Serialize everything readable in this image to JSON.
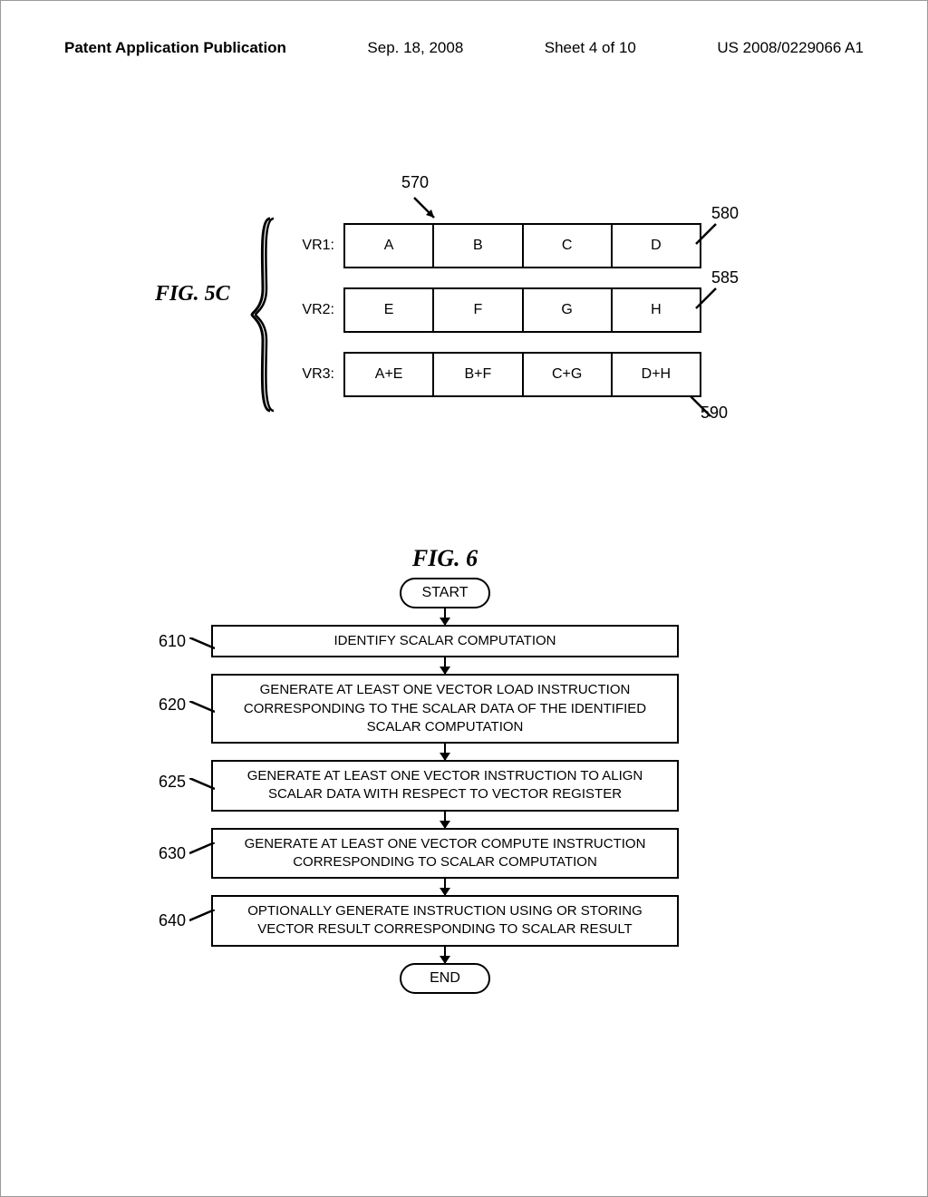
{
  "header": {
    "left": "Patent Application Publication",
    "mid_date": "Sep. 18, 2008",
    "mid_sheet": "Sheet 4 of 10",
    "right": "US 2008/0229066 A1"
  },
  "fig5c": {
    "label": "FIG. 5C",
    "ref570": "570",
    "ref580": "580",
    "ref585": "585",
    "ref590": "590",
    "rows": {
      "vr1_label": "VR1:",
      "vr1": {
        "c0": "A",
        "c1": "B",
        "c2": "C",
        "c3": "D"
      },
      "vr2_label": "VR2:",
      "vr2": {
        "c0": "E",
        "c1": "F",
        "c2": "G",
        "c3": "H"
      },
      "vr3_label": "VR3:",
      "vr3": {
        "c0": "A+E",
        "c1": "B+F",
        "c2": "C+G",
        "c3": "D+H"
      }
    }
  },
  "fig6": {
    "title": "FIG. 6",
    "start": "START",
    "end": "END",
    "step610": {
      "ref": "610",
      "text": "IDENTIFY SCALAR COMPUTATION"
    },
    "step620": {
      "ref": "620",
      "text": "GENERATE AT LEAST ONE VECTOR LOAD INSTRUCTION CORRESPONDING TO THE SCALAR DATA OF THE IDENTIFIED SCALAR COMPUTATION"
    },
    "step625": {
      "ref": "625",
      "text": "GENERATE AT LEAST ONE VECTOR INSTRUCTION TO ALIGN SCALAR DATA WITH RESPECT TO VECTOR REGISTER"
    },
    "step630": {
      "ref": "630",
      "text": "GENERATE AT LEAST ONE VECTOR COMPUTE INSTRUCTION CORRESPONDING TO SCALAR COMPUTATION"
    },
    "step640": {
      "ref": "640",
      "text": "OPTIONALLY GENERATE INSTRUCTION USING OR STORING VECTOR RESULT CORRESPONDING TO SCALAR RESULT"
    }
  }
}
